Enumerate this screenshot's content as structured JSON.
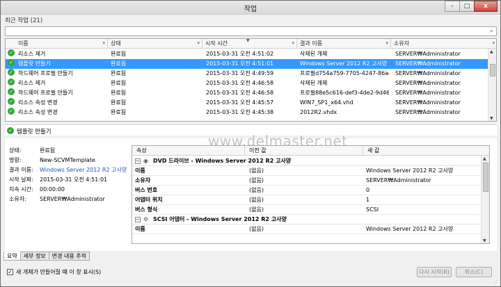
{
  "window": {
    "title": "작업",
    "minimize": "–",
    "restore": "□",
    "close": "x"
  },
  "recent_label": "최근 작업 (21)",
  "jobs": {
    "columns": [
      "이름",
      "상태",
      "시작 시간",
      "결과 이름",
      "소유자"
    ],
    "rows": [
      {
        "name": "리소스 제거",
        "status": "완료됨",
        "start": "2015-03-31 오전 4:51:02",
        "result": "삭제된 개체",
        "owner": "SERVER₩Administrator"
      },
      {
        "name": "템플릿 만들기",
        "status": "완료됨",
        "start": "2015-03-31 오전 4:51:01",
        "result": "Windows Server 2012 R2 고사양",
        "owner": "SERVER₩Administrator"
      },
      {
        "name": "하드웨어 프로필 만들기",
        "status": "완료됨",
        "start": "2015-03-31 오전 4:49:59",
        "result": "프로필d754a759-7705-4247-86ae-...",
        "owner": "SERVER₩Administrator"
      },
      {
        "name": "리소스 제거",
        "status": "완료됨",
        "start": "2015-03-31 오전 4:46:58",
        "result": "삭제된 개체",
        "owner": "SERVER₩Administrator"
      },
      {
        "name": "하드웨어 프로필 만들기",
        "status": "완료됨",
        "start": "2015-03-31 오전 4:46:58",
        "result": "프로필88e5c616-def3-4de2-9d46-...",
        "owner": "SERVER₩Administrator"
      },
      {
        "name": "리소스 속성 변경",
        "status": "완료됨",
        "start": "2015-03-31 오전 4:45:57",
        "result": "WIN7_SP1_x64.vhd",
        "owner": "SERVER₩Administrator"
      },
      {
        "name": "리소스 속성 변경",
        "status": "완료됨",
        "start": "2015-03-31 오전 4:45:38",
        "result": "2012R2.vhdx",
        "owner": "SERVER₩Administrator"
      }
    ]
  },
  "detail": {
    "header": "템플릿 만들기",
    "summary": [
      {
        "k": "상태:",
        "v": "완료됨"
      },
      {
        "k": "명령:",
        "v": "New-SCVMTemplate"
      },
      {
        "k": "결과 이름:",
        "v": "Windows Server 2012 R2 고사양"
      },
      {
        "k": "시작 날짜:",
        "v": "2015-03-31 오전 4:51:01"
      },
      {
        "k": "지속 시간:",
        "v": "00:00:00"
      },
      {
        "k": "소유자:",
        "v": "SERVER₩Administrator"
      }
    ]
  },
  "watermark": "www.delmaster.net",
  "props": {
    "columns": [
      "속성",
      "이전 값",
      "새 값"
    ],
    "group1": "DVD 드라이브 - Windows Server 2012 R2 고사양",
    "group2": "SCSI 어댑터 - Windows Server 2012 R2 고사양",
    "rows1": [
      {
        "p": "이름",
        "old": "(없음)",
        "new": "Windows Server 2012 R2 고사양"
      },
      {
        "p": "소유자",
        "old": "(없음)",
        "new": "SERVER₩Administrator"
      },
      {
        "p": "버스 번호",
        "old": "(없음)",
        "new": "0"
      },
      {
        "p": "어댑터 위치",
        "old": "(없음)",
        "new": "1"
      },
      {
        "p": "버스 형식",
        "old": "(없음)",
        "new": "SCSI"
      }
    ],
    "rows2": [
      {
        "p": "이름",
        "old": "(없음)",
        "new": "Windows Server 2012 R2 고사양"
      }
    ]
  },
  "tabs": [
    "요약",
    "세부 정보",
    "변경 내용 추적"
  ],
  "footer": {
    "checkbox_label": "새 개체가 만들어질 때 이 창 표시(S)",
    "restart_button": "다시 시작(R)",
    "cancel_button": "취소(C)"
  }
}
